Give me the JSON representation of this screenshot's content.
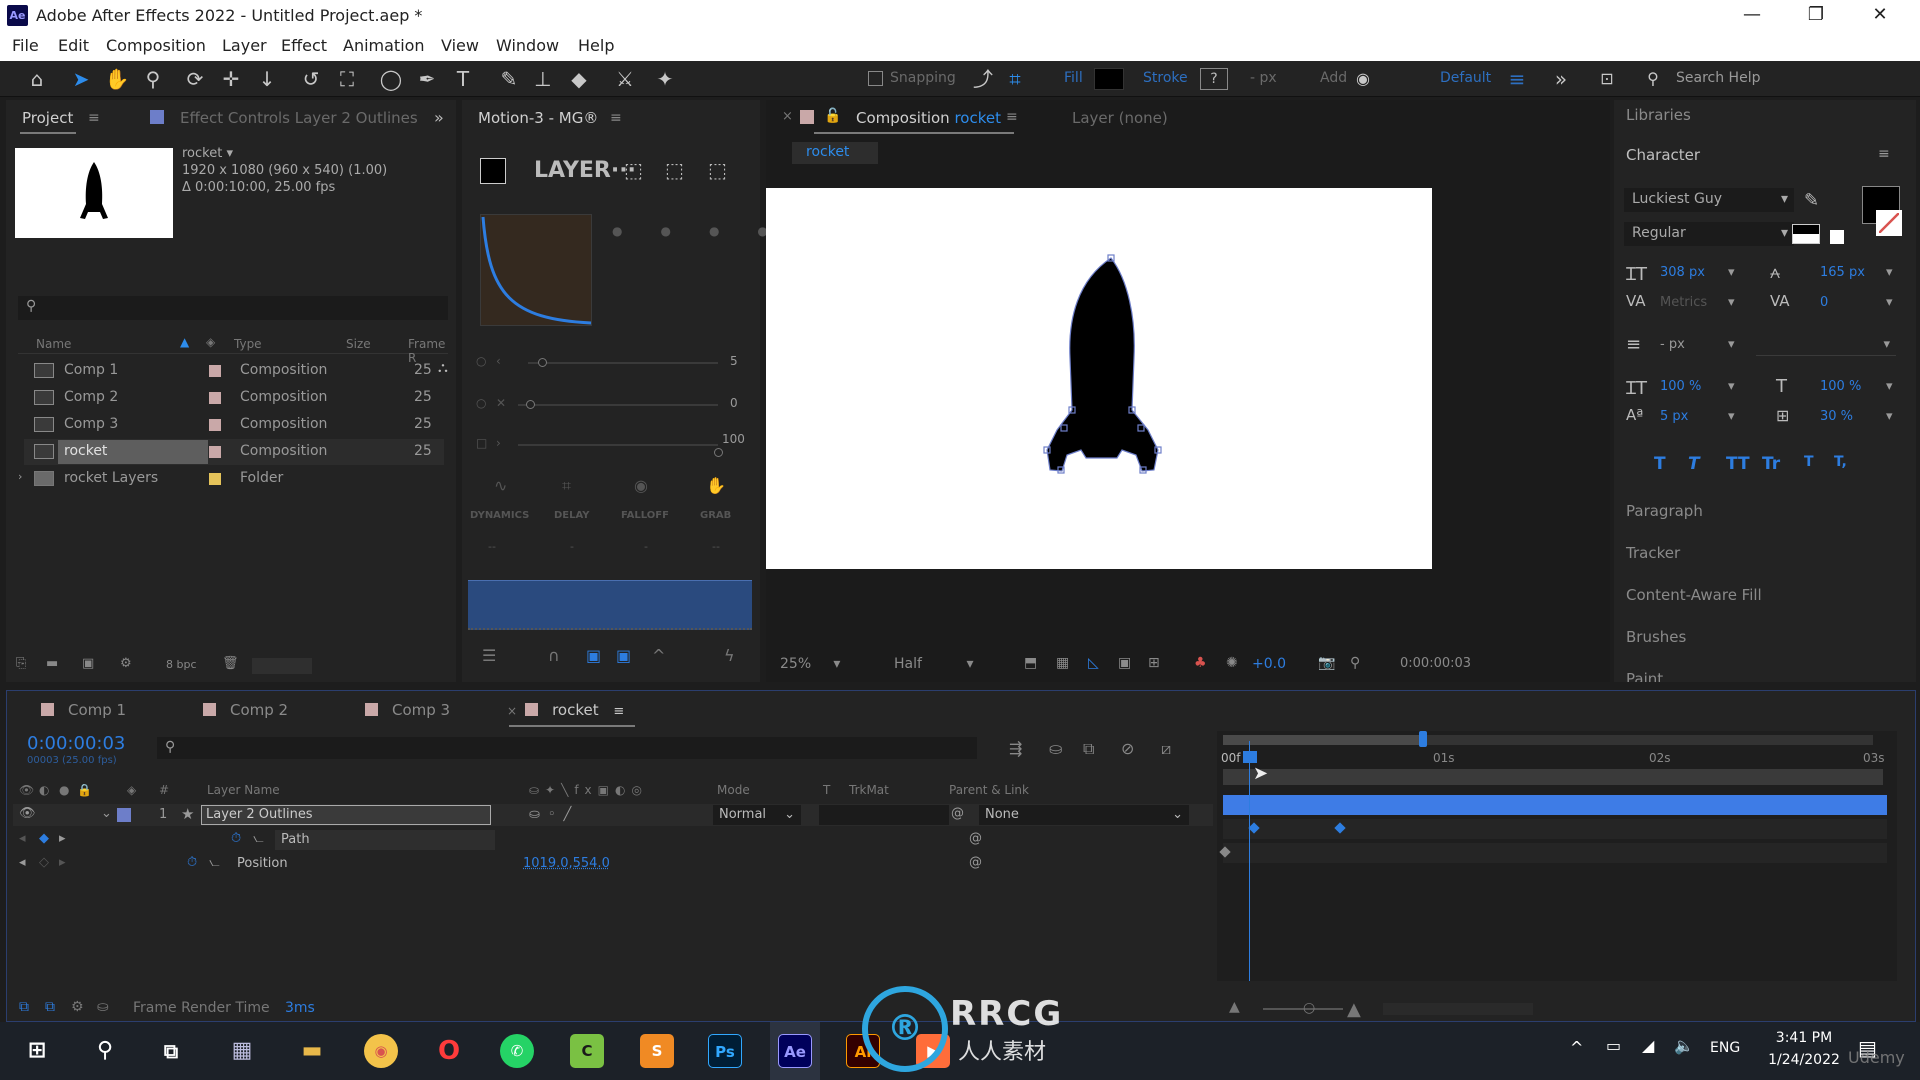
{
  "window": {
    "title": "Adobe After Effects 2022 - Untitled Project.aep *",
    "app_icon_text": "Ae",
    "minimize": "—",
    "maximize": "❐",
    "close": "✕"
  },
  "menu": [
    "File",
    "Edit",
    "Composition",
    "Layer",
    "Effect",
    "Animation",
    "View",
    "Window",
    "Help"
  ],
  "toolbar": {
    "snapping": "Snapping",
    "fill": "Fill",
    "stroke": "Stroke",
    "stroke_help": "?",
    "px": "- px",
    "add": "Add",
    "workspace": "Default",
    "search_placeholder": "Search Help"
  },
  "project_panel": {
    "tab": "Project",
    "effect_controls_tab": "Effect Controls Layer 2 Outlines",
    "selected_name": "rocket ▾",
    "info_line1": "1920 x 1080 (960 x 540) (1.00)",
    "info_line2": "Δ 0:00:10:00, 25.00 fps",
    "search_icon": "⚲",
    "columns": {
      "name": "Name",
      "type": "Type",
      "size": "Size",
      "frame": "Frame R"
    },
    "items": [
      {
        "name": "Comp 1",
        "type": "Composition",
        "frame": "25"
      },
      {
        "name": "Comp 2",
        "type": "Composition",
        "frame": "25"
      },
      {
        "name": "Comp 3",
        "type": "Composition",
        "frame": "25"
      },
      {
        "name": "rocket",
        "type": "Composition",
        "frame": "25"
      },
      {
        "name": "rocket Layers",
        "type": "Folder",
        "frame": ""
      }
    ],
    "bpc": "8 bpc"
  },
  "motion_panel": {
    "tab": "Motion-3 - MG®",
    "layer_label": "LAYER···",
    "slider1_value": "5",
    "slider2_value": "0",
    "slider3_value": "100",
    "labels": [
      "DYNAMICS",
      "DELAY",
      "FALLOFF",
      "GRAB"
    ],
    "dashes": [
      "--",
      "-",
      "-",
      "--"
    ]
  },
  "composition_panel": {
    "tab_prefix": "Composition",
    "tab_name": "rocket",
    "layer_tab": "Layer (none)",
    "breadcrumb": "rocket",
    "zoom": "25%",
    "resolution": "Half",
    "exposure": "+0.0",
    "timecode": "0:00:00:03"
  },
  "right_panel": {
    "libraries": "Libraries",
    "character": "Character",
    "font": "Luckiest Guy",
    "style": "Regular",
    "font_size": "308 px",
    "leading": "165 px",
    "kerning": "Metrics",
    "tracking": "0",
    "stroke_width": "- px",
    "vscale": "100 %",
    "hscale": "100 %",
    "baseline": "5 px",
    "tsume": "30 %",
    "type_buttons": [
      "T",
      "T",
      "TT",
      "Tr",
      "T",
      "T,"
    ],
    "sections": [
      "Paragraph",
      "Tracker",
      "Content-Aware Fill",
      "Brushes",
      "Paint"
    ]
  },
  "timeline": {
    "tabs": [
      "Comp 1",
      "Comp 2",
      "Comp 3",
      "rocket"
    ],
    "timecode": "0:00:00:03",
    "timecode_sub": "00003 (25.00 fps)",
    "columns": {
      "layer_name": "Layer Name",
      "mode": "Mode",
      "t": "T",
      "trkmat": "TrkMat",
      "parent": "Parent & Link"
    },
    "layer": {
      "index": "1",
      "name": "Layer 2 Outlines",
      "mode": "Normal",
      "parent": "None"
    },
    "props": [
      {
        "name": "Path",
        "value": ""
      },
      {
        "name": "Position",
        "value": "1019.0,554.0"
      }
    ],
    "ruler": [
      "00f",
      "01s",
      "02s",
      "03s"
    ],
    "render_time_label": "Frame Render Time",
    "render_time_value": "3ms"
  },
  "watermark": {
    "main": "RRCG",
    "sub": "人人素材",
    "corner": "Udemy"
  },
  "taskbar": {
    "time": "3:41 PM",
    "date": "1/24/2022",
    "lang": "ENG",
    "ps": "Ps",
    "ae": "Ae",
    "ai": "Ai"
  }
}
